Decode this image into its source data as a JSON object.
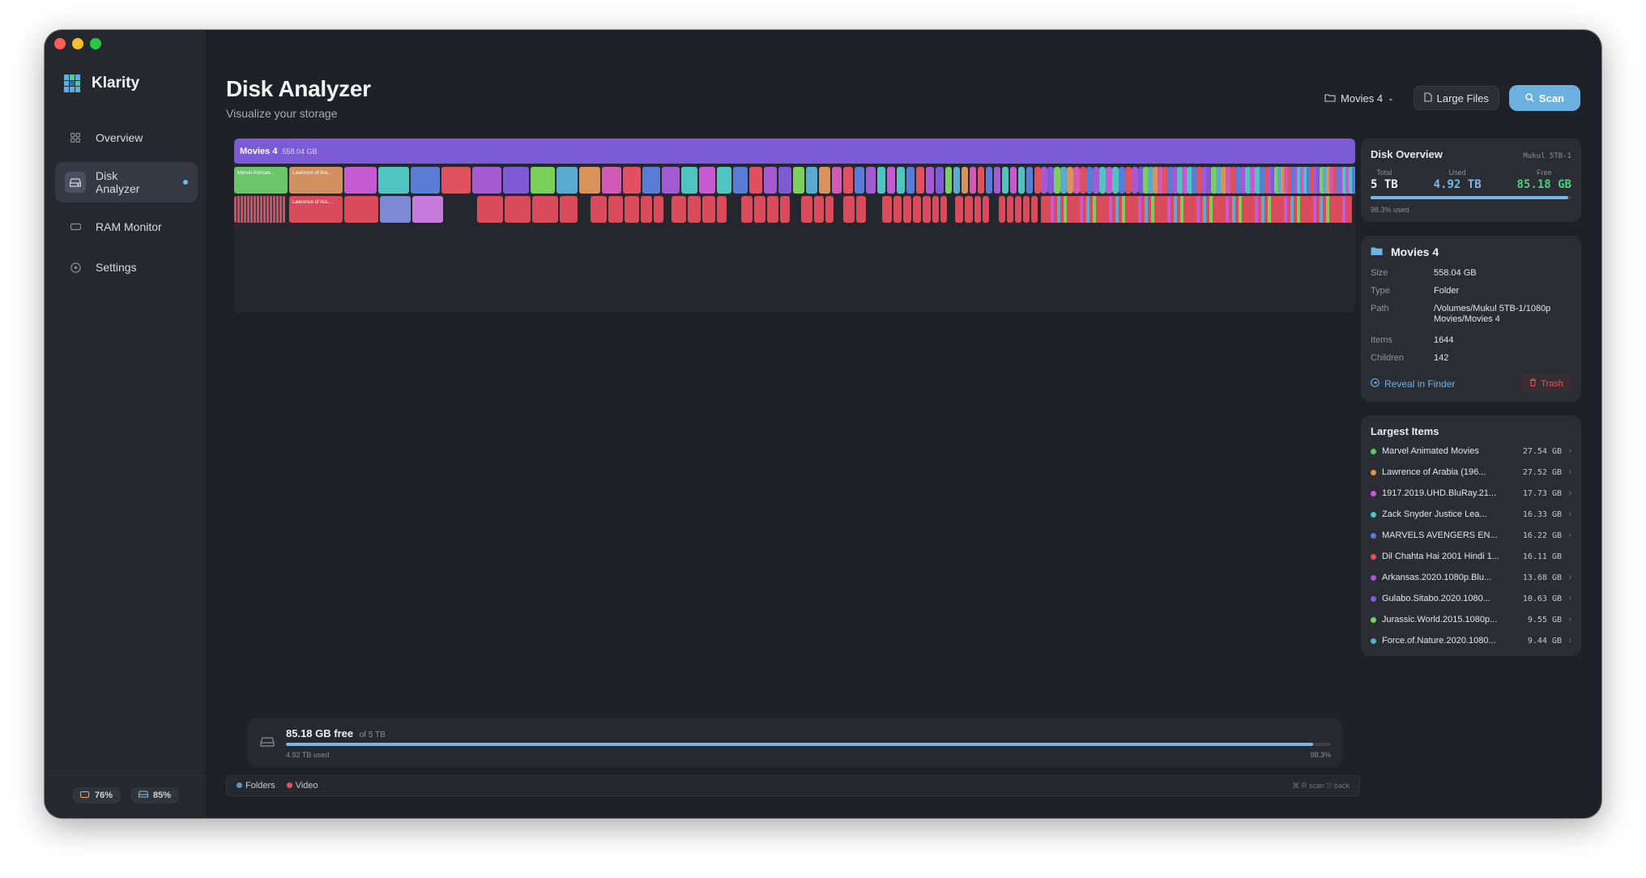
{
  "app": {
    "name": "Klarity"
  },
  "sidebar": {
    "items": [
      {
        "label": "Overview",
        "icon": "grid-icon"
      },
      {
        "label": "Disk Analyzer",
        "icon": "disk-icon",
        "active": true
      },
      {
        "label": "RAM Monitor",
        "icon": "ram-icon"
      },
      {
        "label": "Settings",
        "icon": "gear-icon"
      }
    ],
    "footer": {
      "cpu": "76%",
      "disk": "85%"
    }
  },
  "header": {
    "title": "Disk Analyzer",
    "subtitle": "Visualize your storage",
    "folder_select": "Movies 4",
    "large_files": "Large Files",
    "scan": "Scan"
  },
  "treemap": {
    "root_name": "Movies 4",
    "root_size": "558.04 GB",
    "label_1": "Marvel Animate...",
    "label_2": "Lawrence of Ara...",
    "label_3": "Lawrence of Ara..."
  },
  "diskbar": {
    "free": "85.18 GB free",
    "of": "of 5 TB",
    "used": "4.92 TB used",
    "pct": "98.3%",
    "fraction": 0.983
  },
  "legend": {
    "folders": "Folders",
    "video": "Video",
    "hint": "⌘ R scan  ⎋ back"
  },
  "overview": {
    "title": "Disk Overview",
    "disk": "Mukul 5TB-1",
    "total_label": "Total",
    "total": "5 TB",
    "used_label": "Used",
    "used": "4.92 TB",
    "free_label": "Free",
    "free": "85.18 GB",
    "used_pct": "98.3% used",
    "fraction": 0.983
  },
  "details": {
    "name": "Movies 4",
    "size_k": "Size",
    "size": "558.04 GB",
    "type_k": "Type",
    "type": "Folder",
    "path_k": "Path",
    "path": "/Volumes/Mukul 5TB-1/1080p Movies/Movies 4",
    "items_k": "Items",
    "items": "1644",
    "children_k": "Children",
    "children": "142",
    "reveal": "Reveal in Finder",
    "trash": "Trash"
  },
  "largest": {
    "title": "Largest Items",
    "items": [
      {
        "name": "Marvel Animated Movies",
        "size": "27.54 GB",
        "color": "#5ec46a",
        "chev": "›"
      },
      {
        "name": "Lawrence of Arabia (196...",
        "size": "27.52 GB",
        "color": "#d9925a",
        "chev": "›"
      },
      {
        "name": "1917.2019.UHD.BluRay.21...",
        "size": "17.73 GB",
        "color": "#c65ad2",
        "chev": "›"
      },
      {
        "name": "Zack Snyder Justice Lea...",
        "size": "16.33 GB",
        "color": "#4fc4c0",
        "chev": "›"
      },
      {
        "name": "MARVELS AVENGERS EN...",
        "size": "16.22 GB",
        "color": "#5a7bd6",
        "chev": "›"
      },
      {
        "name": "Dil Chahta Hai 2001 Hindi 1...",
        "size": "16.11 GB",
        "color": "#e0505e",
        "chev": ""
      },
      {
        "name": "Arkansas.2020.1080p.Blu...",
        "size": "13.68 GB",
        "color": "#a45ad2",
        "chev": "›"
      },
      {
        "name": "Gulabo.Sitabo.2020.1080...",
        "size": "10.63 GB",
        "color": "#7e5ad6",
        "chev": "›"
      },
      {
        "name": "Jurassic.World.2015.1080p...",
        "size": "9.55 GB",
        "color": "#7ad05a",
        "chev": "›"
      },
      {
        "name": "Force.of.Nature.2020.1080...",
        "size": "9.44 GB",
        "color": "#5aaad2",
        "chev": "›"
      }
    ]
  },
  "colors": {
    "accent": "#6bb0df",
    "purple": "#7b5cd6",
    "red": "#e0505e",
    "free_green": "#4cd07a"
  }
}
